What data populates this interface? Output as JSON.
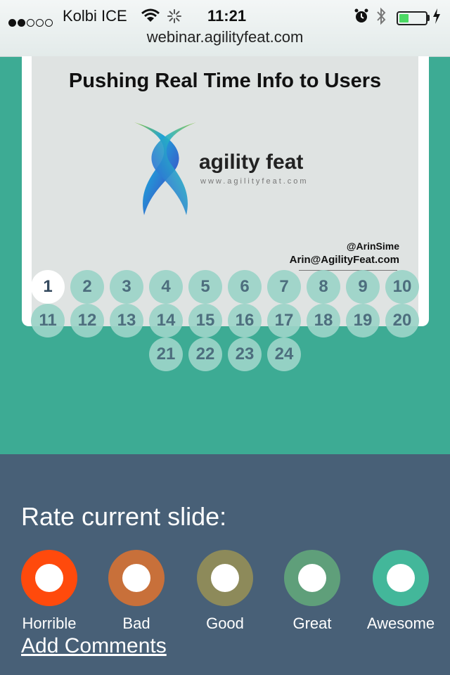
{
  "status_bar": {
    "carrier": "Kolbi ICE",
    "time": "11:21",
    "battery_level": 0.35
  },
  "browser": {
    "url": "webinar.agilityfeat.com"
  },
  "slide": {
    "title": "Pushing Real Time Info to Users",
    "logo_text": "agility feat",
    "logo_url": "www.agilityfeat.com",
    "handle": "@ArinSime",
    "email": "Arin@AgilityFeat.com"
  },
  "pagination": {
    "current": 1,
    "pages": [
      "1",
      "2",
      "3",
      "4",
      "5",
      "6",
      "7",
      "8",
      "9",
      "10",
      "11",
      "12",
      "13",
      "14",
      "15",
      "16",
      "17",
      "18",
      "19",
      "20",
      "21",
      "22",
      "23",
      "24"
    ]
  },
  "rating": {
    "heading": "Rate current slide:",
    "options": [
      {
        "label": "Horrible",
        "color": "#ff4a0c"
      },
      {
        "label": "Bad",
        "color": "#c8703a"
      },
      {
        "label": "Good",
        "color": "#8d8a5a"
      },
      {
        "label": "Great",
        "color": "#5f9f7a"
      },
      {
        "label": "Awesome",
        "color": "#43b79a"
      }
    ],
    "add_comments": "Add Comments"
  }
}
